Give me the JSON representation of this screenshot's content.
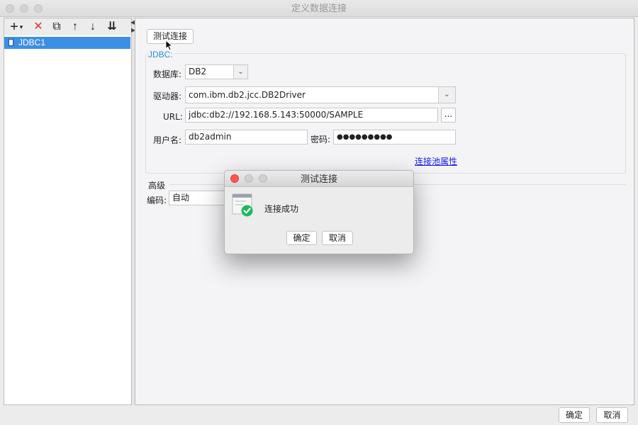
{
  "window": {
    "title": "定义数据连接"
  },
  "left_panel": {
    "toolbar": {
      "add": "+",
      "add_menu": "▾",
      "delete": "✕",
      "copy": "⧉",
      "move_up": "↑",
      "move_down": "↓",
      "import": "⇊"
    },
    "connections": [
      {
        "label": "JDBC1",
        "selected": true
      }
    ]
  },
  "right_panel": {
    "test_button": "测试连接",
    "jdbc_group": {
      "title": "JDBC:",
      "database_label": "数据库:",
      "database_value": "DB2",
      "driver_label": "驱动器:",
      "driver_value": "com.ibm.db2.jcc.DB2Driver",
      "url_label": "URL:",
      "url_value": "jdbc:db2://192.168.5.143:50000/SAMPLE",
      "url_more": "...",
      "username_label": "用户名:",
      "username_value": "db2admin",
      "password_label": "密码:",
      "password_value": "●●●●●●●●●",
      "pool_link": "连接池属性"
    },
    "advanced": {
      "title": "高级",
      "encoding_label": "编码:",
      "encoding_value": "自动"
    }
  },
  "dialog": {
    "title": "测试连接",
    "message": "连接成功",
    "ok": "确定",
    "cancel": "取消"
  },
  "footer": {
    "ok": "确定",
    "cancel": "取消"
  },
  "colors": {
    "accent": "#3d8fe4",
    "group_title": "#2b8fd2",
    "link": "#1a1aee",
    "success": "#1fb85c",
    "delete": "#e0302a"
  }
}
